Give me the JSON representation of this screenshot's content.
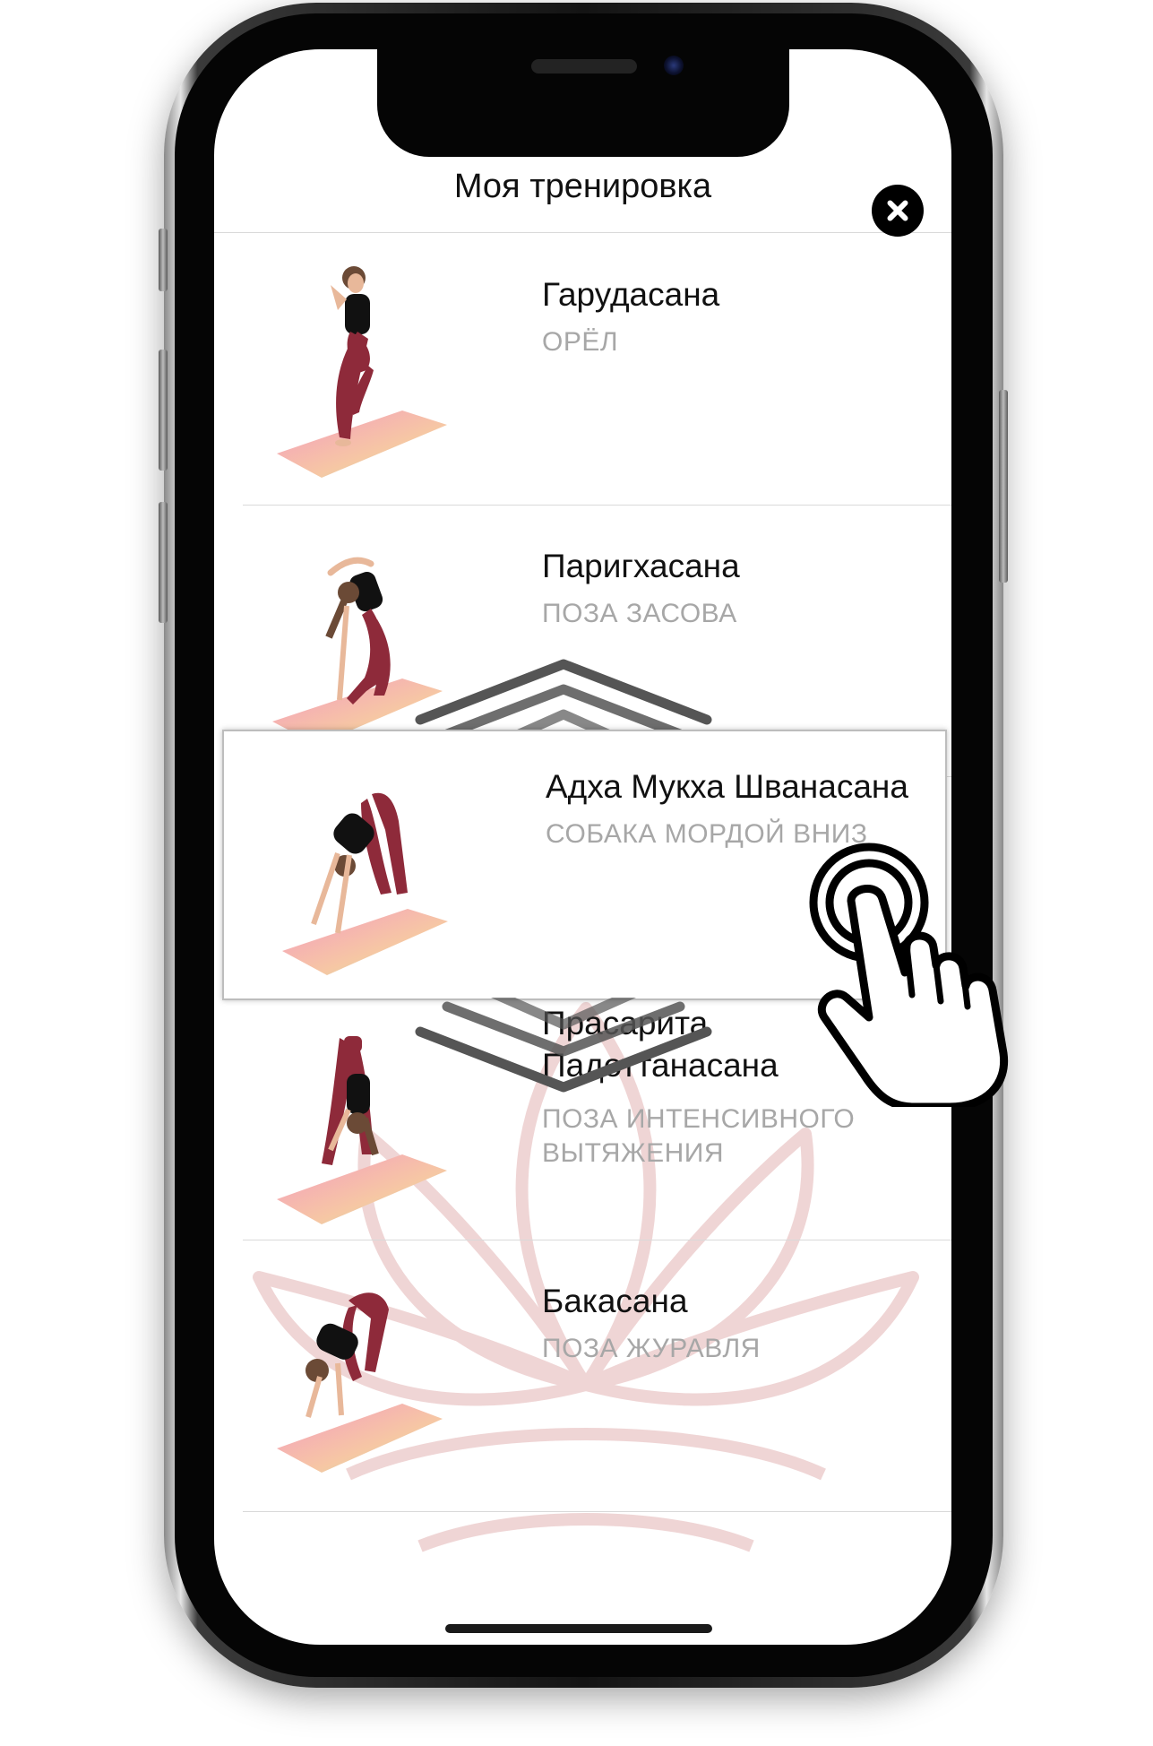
{
  "header": {
    "title": "Моя тренировка"
  },
  "poses": [
    {
      "name": "Гарудасана",
      "subtitle": "ОРЁЛ"
    },
    {
      "name": "Паригхасана",
      "subtitle": "ПОЗА ЗАСОВА"
    },
    {
      "name": "Адха Мукха Шванасана",
      "subtitle": "СОБАКА МОРДОЙ ВНИЗ"
    },
    {
      "name": "Прасарита Падоттанасана",
      "subtitle": "ПОЗА ИНТЕНСИВНОГО ВЫТЯЖЕНИЯ"
    },
    {
      "name": "Бакасана",
      "subtitle": "ПОЗА ЖУРАВЛЯ"
    }
  ],
  "colors": {
    "leggings": "#8e2a3a",
    "shirt": "#111111",
    "skin": "#e8b89a",
    "lotus": "#d9a0a0",
    "mat_start": "#f49ac1",
    "mat_end": "#b8e6a8"
  },
  "icons": [
    "close-icon",
    "drag-chevron-up-icon",
    "drag-chevron-down-icon",
    "tap-hand-icon",
    "lotus-watermark-icon"
  ]
}
